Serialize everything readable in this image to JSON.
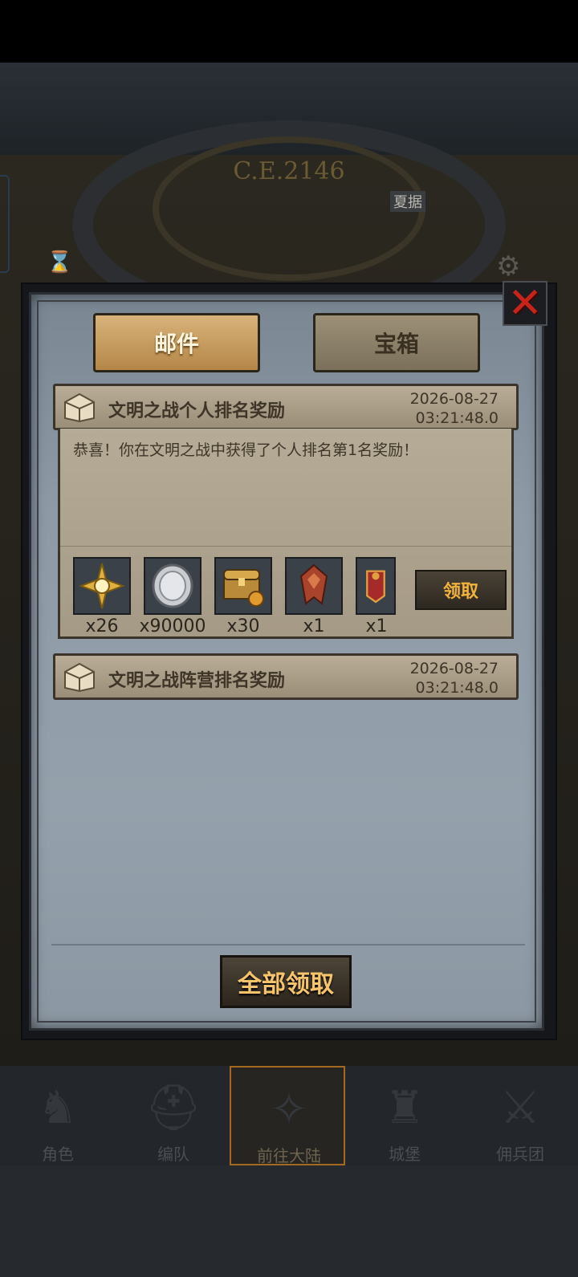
{
  "background": {
    "era_label": "C.E.2146",
    "small_label": "夏据"
  },
  "dialog": {
    "close_glyph": "✕",
    "tabs": [
      {
        "label": "邮件",
        "active": true
      },
      {
        "label": "宝箱",
        "active": false
      }
    ],
    "mails": [
      {
        "title": "文明之战个人排名奖励",
        "date": "2026-08-27",
        "time": "03:21:48.0",
        "body": "恭喜！你在文明之战中获得了个人排名第1名奖励！",
        "rewards": [
          {
            "icon": "compass-star-icon",
            "qty": "x26"
          },
          {
            "icon": "silver-coin-icon",
            "qty": "x90000"
          },
          {
            "icon": "treasure-chest-icon",
            "qty": "x30"
          },
          {
            "icon": "red-badge-icon",
            "qty": "x1"
          },
          {
            "icon": "banner-shield-icon",
            "qty": "x1"
          }
        ],
        "claim_label": "领取"
      },
      {
        "title": "文明之战阵营排名奖励",
        "date": "2026-08-27",
        "time": "03:21:48.0"
      }
    ],
    "claim_all_label": "全部领取"
  },
  "bottom_nav": [
    {
      "label": "角色",
      "icon": "knight-icon"
    },
    {
      "label": "编队",
      "icon": "helmet-icon"
    },
    {
      "label": "前往大陆",
      "icon": "compass-icon",
      "active": true
    },
    {
      "label": "城堡",
      "icon": "castle-icon"
    },
    {
      "label": "佣兵团",
      "icon": "mercenary-icon"
    }
  ],
  "colors": {
    "accent": "#f2b23c",
    "close": "#c8231b",
    "tab_active": "#d8b37a"
  }
}
